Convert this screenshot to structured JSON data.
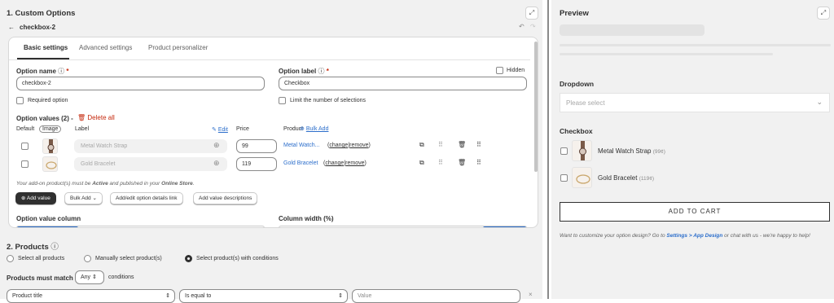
{
  "left": {
    "section1_title": "1. Custom Options",
    "back_label": "checkbox-2",
    "tabs": [
      "Basic settings",
      "Advanced settings",
      "Product personalizer"
    ],
    "option_name": {
      "label": "Option name",
      "required_star": "*",
      "value": "checkbox-2"
    },
    "option_label": {
      "label": "Option label",
      "required_star": "*",
      "value": "Checkbox",
      "hidden_label": "Hidden"
    },
    "required_option": "Required option",
    "limit_selections": "Limit the number of selections",
    "option_values": {
      "title": "Option values (2) -",
      "delete_all": "Delete all"
    },
    "columns": {
      "default": "Default",
      "image": "Image",
      "label": "Label",
      "edit": "Edit",
      "price": "Price",
      "product": "Product",
      "bulk_add": "Bulk Add"
    },
    "rows": [
      {
        "label": "Metal Watch Strap",
        "price": "99",
        "product": "Metal Watch...",
        "change": "change",
        "remove": "remove"
      },
      {
        "label": "Gold Bracelet",
        "price": "119",
        "product": "Gold Bracelet",
        "change": "change",
        "remove": "remove"
      }
    ],
    "addon_note_prefix": "Your add-on product(s) must be ",
    "addon_note_active": "Active",
    "addon_note_mid": " and published in your ",
    "addon_note_store": "Online Store",
    "addon_note_end": ".",
    "buttons": {
      "add_value": "Add value",
      "bulk_add": "Bulk Add",
      "add_edit": "Add/edit option details link",
      "add_desc": "Add value descriptions"
    },
    "option_value_column": "Option value column",
    "column_width": "Column width (%)",
    "section2_title": "2. Products",
    "radios": [
      "Select all products",
      "Manually select product(s)",
      "Select product(s) with conditions"
    ],
    "must_match": "Products must match",
    "match_value": "Any",
    "conditions": "conditions",
    "condition_row": {
      "field": "Product title",
      "operator": "Is equal to",
      "value_placeholder": "Value"
    }
  },
  "preview": {
    "title": "Preview",
    "dropdown_title": "Dropdown",
    "dropdown_placeholder": "Please select",
    "checkbox_title": "Checkbox",
    "items": [
      {
        "label": "Metal Watch Strap",
        "price": "(99¢)"
      },
      {
        "label": "Gold Bracelet",
        "price": "(119¢)"
      }
    ],
    "add_to_cart": "ADD TO CART",
    "note_prefix": "Want to customize your option design? Go to ",
    "note_link": "Settings > App Design",
    "note_suffix": " or  chat with us - we're happy to help!"
  }
}
